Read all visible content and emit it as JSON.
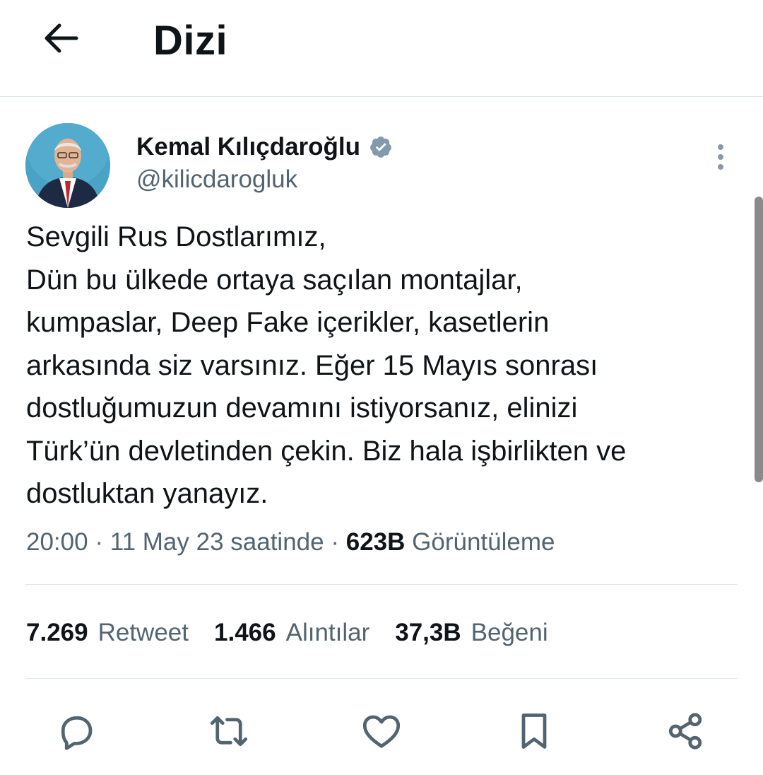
{
  "header": {
    "title": "Dizi",
    "back_icon": "arrow-left-icon"
  },
  "tweet": {
    "author": {
      "name": "Kemal Kılıçdaroğlu",
      "handle": "@kilicdarogluk",
      "verified": true,
      "verified_color": "#829aab"
    },
    "text_lines": [
      "Sevgili Rus Dostlarımız,",
      "Dün bu ülkede ortaya saçılan montajlar,",
      "kumpaslar, Deep Fake içerikler, kasetlerin",
      "arkasında siz varsınız. Eğer 15 Mayıs sonrası",
      "dostluğumuzun devamını istiyorsanız, elinizi",
      "Türk’ün devletinden çekin. Biz hala işbirlikten ve",
      "dostluktan yanayız."
    ],
    "meta": {
      "time": "20:00",
      "separator": "·",
      "date": "11 May 23 saatinde",
      "views": "623B",
      "views_label": "Görüntüleme"
    },
    "stats": {
      "retweets": "7.269",
      "retweets_label": "Retweet",
      "quotes": "1.466",
      "quotes_label": "Alıntılar",
      "likes": "37,3B",
      "likes_label": "Beğeni"
    },
    "actions": [
      "reply-icon",
      "retweet-icon",
      "like-icon",
      "bookmark-icon",
      "share-icon"
    ]
  },
  "colors": {
    "text": "#0f1419",
    "secondary": "#536471",
    "divider": "#e1e6ea",
    "avatar_bg": "#4aa3c7"
  }
}
